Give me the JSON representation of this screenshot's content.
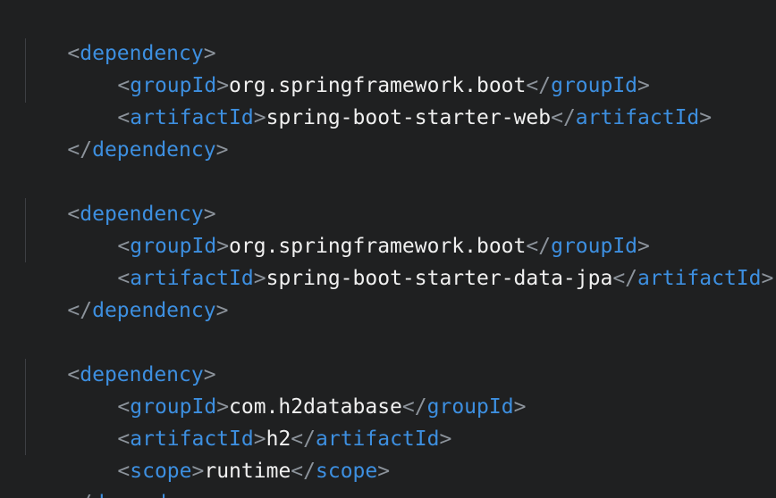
{
  "code": {
    "punctuation": {
      "open": "<",
      "close": ">",
      "end_open": "</"
    },
    "blocks": [
      {
        "open_tag": "dependency",
        "close_tag": "dependency",
        "children": [
          {
            "tag": "groupId",
            "value": "org.springframework.boot"
          },
          {
            "tag": "artifactId",
            "value": "spring-boot-starter-web"
          }
        ]
      },
      {
        "open_tag": "dependency",
        "close_tag": "dependency",
        "children": [
          {
            "tag": "groupId",
            "value": "org.springframework.boot"
          },
          {
            "tag": "artifactId",
            "value": "spring-boot-starter-data-jpa"
          }
        ]
      },
      {
        "open_tag": "dependency",
        "close_tag": "dependency",
        "children": [
          {
            "tag": "groupId",
            "value": "com.h2database"
          },
          {
            "tag": "artifactId",
            "value": "h2"
          },
          {
            "tag": "scope",
            "value": "runtime"
          }
        ]
      }
    ]
  },
  "colors": {
    "background": "#1f2021",
    "tag": "#3d8fe0",
    "punctuation": "#8c939b",
    "text": "#f0f0f0"
  }
}
